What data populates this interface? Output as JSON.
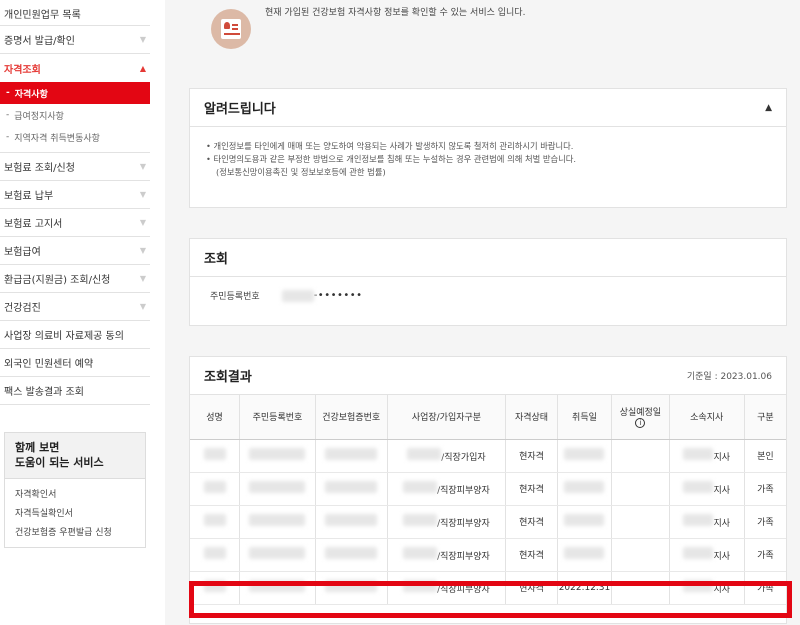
{
  "sidebar": {
    "top": "개인민원업무 목록",
    "items": [
      {
        "label": "증명서 발급/확인"
      },
      {
        "label": "자격조회"
      }
    ],
    "sub_items": [
      "자격사항",
      "급여정지사항",
      "지역자격 취득변동사항"
    ],
    "items_after": [
      "보험료 조회/신청",
      "보험료 납부",
      "보험료 고지서",
      "보험급여",
      "환급금(지원금) 조회/신청",
      "건강검진"
    ],
    "plain_items": [
      "사업장 의료비 자료제공 동의",
      "외국인 민원센터 예약",
      "팩스 발송결과 조회"
    ],
    "service_box": {
      "title_line1": "함께 보면",
      "title_line2": "도움이 되는 서비스",
      "links": [
        "자격확인서",
        "자격득실확인서",
        "건강보험증 우편발급 신청"
      ]
    }
  },
  "intro": {
    "text": "현재 가입된 건강보험 자격사항 정보를 확인할 수 있는 서비스 입니다."
  },
  "notice": {
    "title": "알려드립니다",
    "line1": "개인정보를 타인에게 매매 또는 양도하여 악용되는 사례가 발생하지 않도록 철저히 관리하시기 바랍니다.",
    "line2": "타인명의도용과 같은 부정한 방법으로 개인정보를 침해 또는 누설하는 경우 관련법에 의해 처벌 받습니다.",
    "line3": "(정보통신망이용촉진 및 정보보호등에 관한 법률)"
  },
  "lookup": {
    "title": "조회",
    "label": "주민등록번호",
    "masked": "-•••••••"
  },
  "results": {
    "title": "조회결과",
    "base_date": "기준일 : 2023.01.06",
    "headers": [
      "성명",
      "주민등록번호",
      "건강보험증번호",
      "사업장/가입자구분",
      "자격상태",
      "취득일",
      "상실예정일",
      "소속지사",
      "구분"
    ],
    "info_icon": "i",
    "rows": [
      {
        "type_suffix": "/직장가입자",
        "status": "현자격",
        "acq_date": "",
        "branch_suffix": "지사",
        "kind": "본인"
      },
      {
        "type_suffix": "/직장피부양자",
        "status": "현자격",
        "acq_date": "",
        "branch_suffix": "지사",
        "kind": "가족"
      },
      {
        "type_suffix": "/직장피부양자",
        "status": "현자격",
        "acq_date": "",
        "branch_suffix": "지사",
        "kind": "가족"
      },
      {
        "type_suffix": "/직장피부양자",
        "status": "현자격",
        "acq_date": "",
        "branch_suffix": "지사",
        "kind": "가족"
      },
      {
        "type_suffix": "/직장피부양자",
        "status": "현자격",
        "acq_date": "2022.12.31",
        "branch_suffix": "지사",
        "kind": "가족"
      }
    ]
  },
  "colors": {
    "accent": "#e30613",
    "active_text": "#e53935"
  }
}
